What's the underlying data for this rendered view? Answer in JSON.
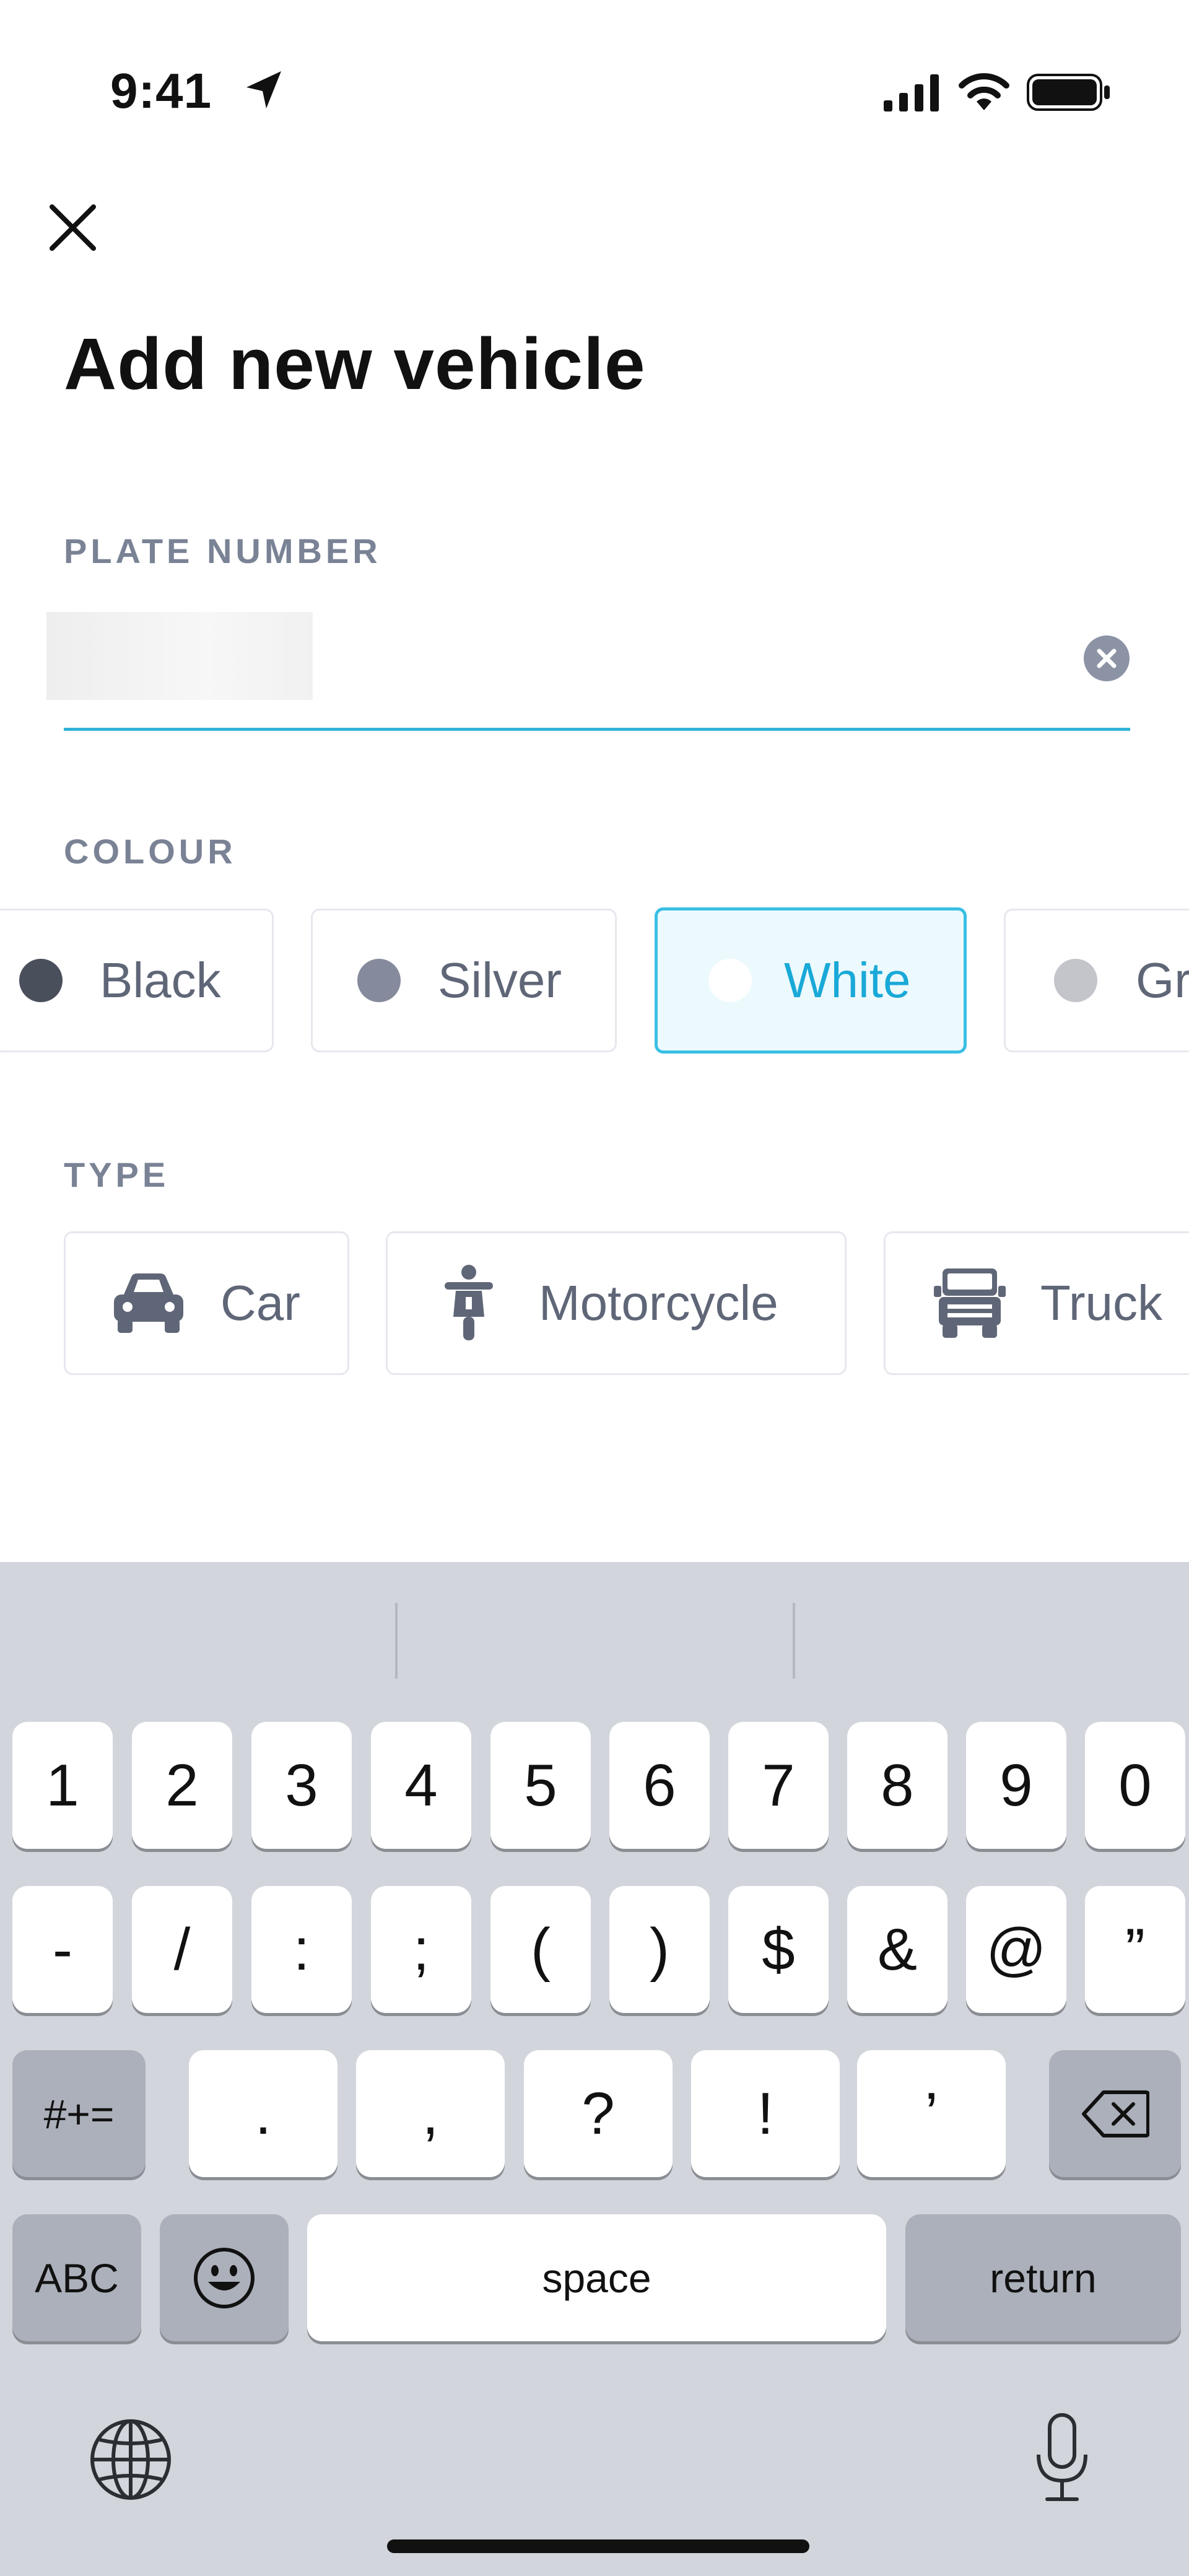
{
  "status_bar": {
    "time": "9:41"
  },
  "header": {
    "title": "Add new vehicle"
  },
  "plate": {
    "label": "PLATE NUMBER",
    "value": ""
  },
  "colour": {
    "label": "COLOUR",
    "selected": "White",
    "options": [
      {
        "name": "Black",
        "color": "#4a4f5c"
      },
      {
        "name": "Silver",
        "color": "#858b9c"
      },
      {
        "name": "White",
        "color": "#ffffff"
      },
      {
        "name": "Gre",
        "color": "#c3c5ca"
      }
    ]
  },
  "type": {
    "label": "TYPE",
    "options": [
      {
        "name": "Car",
        "icon": "car-icon"
      },
      {
        "name": "Motorcycle",
        "icon": "motorcycle-icon"
      },
      {
        "name": "Truck",
        "icon": "truck-icon"
      }
    ]
  },
  "keyboard": {
    "row1": [
      "1",
      "2",
      "3",
      "4",
      "5",
      "6",
      "7",
      "8",
      "9",
      "0"
    ],
    "row2": [
      "-",
      "/",
      ":",
      ";",
      "(",
      ")",
      "$",
      "&",
      "@",
      "”"
    ],
    "row3": {
      "shift": "#+=",
      "keys": [
        ".",
        ",",
        "?",
        "!",
        "’"
      ]
    },
    "row4": {
      "abc": "ABC",
      "space": "space",
      "return": "return"
    }
  }
}
